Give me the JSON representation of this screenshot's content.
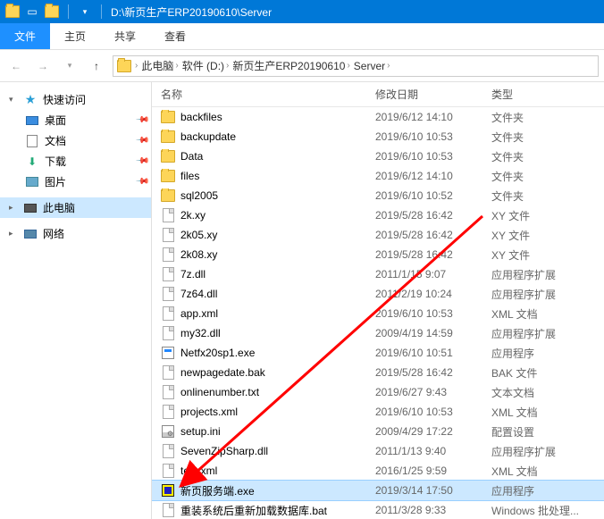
{
  "titlebar": {
    "path": "D:\\新页生产ERP20190610\\Server"
  },
  "ribbon": {
    "tabs": [
      "文件",
      "主页",
      "共享",
      "查看"
    ],
    "activeIndex": 0
  },
  "breadcrumbs": [
    "此电脑",
    "软件 (D:)",
    "新页生产ERP20190610",
    "Server"
  ],
  "sidebar": {
    "quickAccess": {
      "label": "快速访问",
      "expanded": true
    },
    "quickItems": [
      {
        "label": "桌面",
        "icon": "desktop"
      },
      {
        "label": "文档",
        "icon": "docs"
      },
      {
        "label": "下载",
        "icon": "download"
      },
      {
        "label": "图片",
        "icon": "pictures"
      }
    ],
    "thisPC": {
      "label": "此电脑",
      "selected": true
    },
    "network": {
      "label": "网络"
    }
  },
  "columns": {
    "name": "名称",
    "date": "修改日期",
    "type": "类型"
  },
  "files": [
    {
      "name": "backfiles",
      "date": "2019/6/12 14:10",
      "type": "文件夹",
      "icon": "folder"
    },
    {
      "name": "backupdate",
      "date": "2019/6/10 10:53",
      "type": "文件夹",
      "icon": "folder"
    },
    {
      "name": "Data",
      "date": "2019/6/10 10:53",
      "type": "文件夹",
      "icon": "folder"
    },
    {
      "name": "files",
      "date": "2019/6/12 14:10",
      "type": "文件夹",
      "icon": "folder"
    },
    {
      "name": "sql2005",
      "date": "2019/6/10 10:52",
      "type": "文件夹",
      "icon": "folder"
    },
    {
      "name": "2k.xy",
      "date": "2019/5/28 16:42",
      "type": "XY 文件",
      "icon": "doc"
    },
    {
      "name": "2k05.xy",
      "date": "2019/5/28 16:42",
      "type": "XY 文件",
      "icon": "doc"
    },
    {
      "name": "2k08.xy",
      "date": "2019/5/28 16:42",
      "type": "XY 文件",
      "icon": "doc"
    },
    {
      "name": "7z.dll",
      "date": "2011/1/15 9:07",
      "type": "应用程序扩展",
      "icon": "doc"
    },
    {
      "name": "7z64.dll",
      "date": "2011/2/19 10:24",
      "type": "应用程序扩展",
      "icon": "doc"
    },
    {
      "name": "app.xml",
      "date": "2019/6/10 10:53",
      "type": "XML 文档",
      "icon": "doc"
    },
    {
      "name": "my32.dll",
      "date": "2009/4/19 14:59",
      "type": "应用程序扩展",
      "icon": "doc"
    },
    {
      "name": "Netfx20sp1.exe",
      "date": "2019/6/10 10:51",
      "type": "应用程序",
      "icon": "exe"
    },
    {
      "name": "newpagedate.bak",
      "date": "2019/5/28 16:42",
      "type": "BAK 文件",
      "icon": "doc"
    },
    {
      "name": "onlinenumber.txt",
      "date": "2019/6/27 9:43",
      "type": "文本文档",
      "icon": "doc"
    },
    {
      "name": "projects.xml",
      "date": "2019/6/10 10:53",
      "type": "XML 文档",
      "icon": "doc"
    },
    {
      "name": "setup.ini",
      "date": "2009/4/29 17:22",
      "type": "配置设置",
      "icon": "ini"
    },
    {
      "name": "SevenZipSharp.dll",
      "date": "2011/1/13 9:40",
      "type": "应用程序扩展",
      "icon": "doc"
    },
    {
      "name": "test.xml",
      "date": "2016/1/25 9:59",
      "type": "XML 文档",
      "icon": "doc"
    },
    {
      "name": "新页服务端.exe",
      "date": "2019/3/14 17:50",
      "type": "应用程序",
      "icon": "srv",
      "selected": true
    },
    {
      "name": "重装系统后重新加载数据库.bat",
      "date": "2011/3/28 9:33",
      "type": "Windows 批处理...",
      "icon": "doc"
    }
  ]
}
